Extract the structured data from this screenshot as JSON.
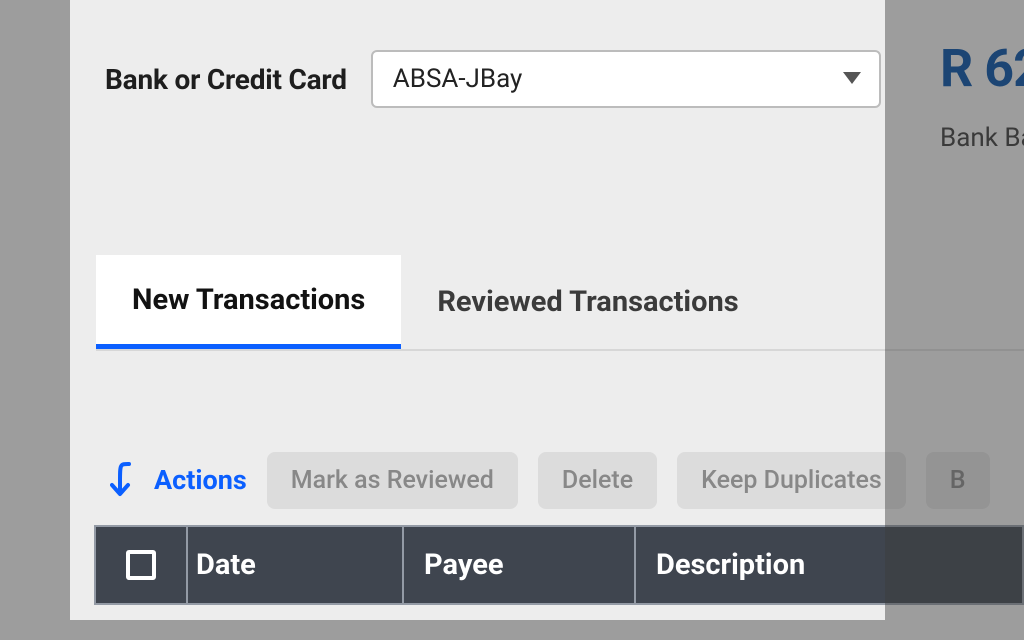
{
  "header": {
    "account_label": "Bank or Credit Card",
    "account_selected": "ABSA-JBay"
  },
  "balance": {
    "amount": "R 62",
    "caption": "Bank Ba"
  },
  "tabs": {
    "new": "New Transactions",
    "reviewed": "Reviewed Transactions"
  },
  "actions": {
    "label": "Actions",
    "mark_reviewed": "Mark as Reviewed",
    "delete": "Delete",
    "keep_duplicates": "Keep Duplicates",
    "extra": "B"
  },
  "table": {
    "columns": {
      "date": "Date",
      "payee": "Payee",
      "description": "Description"
    }
  }
}
